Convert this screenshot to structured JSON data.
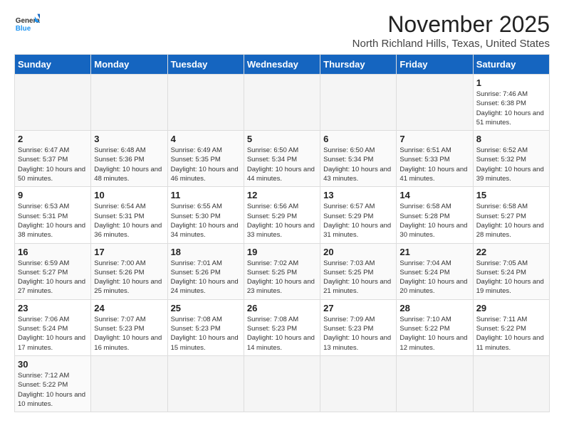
{
  "app": {
    "logo_general": "General",
    "logo_blue": "Blue"
  },
  "header": {
    "month": "November 2025",
    "location": "North Richland Hills, Texas, United States"
  },
  "weekdays": [
    "Sunday",
    "Monday",
    "Tuesday",
    "Wednesday",
    "Thursday",
    "Friday",
    "Saturday"
  ],
  "weeks": [
    [
      {
        "day": null,
        "info": null
      },
      {
        "day": null,
        "info": null
      },
      {
        "day": null,
        "info": null
      },
      {
        "day": null,
        "info": null
      },
      {
        "day": null,
        "info": null
      },
      {
        "day": null,
        "info": null
      },
      {
        "day": "1",
        "info": "Sunrise: 7:46 AM\nSunset: 6:38 PM\nDaylight: 10 hours\nand 51 minutes."
      }
    ],
    [
      {
        "day": "2",
        "info": "Sunrise: 6:47 AM\nSunset: 5:37 PM\nDaylight: 10 hours\nand 50 minutes."
      },
      {
        "day": "3",
        "info": "Sunrise: 6:48 AM\nSunset: 5:36 PM\nDaylight: 10 hours\nand 48 minutes."
      },
      {
        "day": "4",
        "info": "Sunrise: 6:49 AM\nSunset: 5:35 PM\nDaylight: 10 hours\nand 46 minutes."
      },
      {
        "day": "5",
        "info": "Sunrise: 6:50 AM\nSunset: 5:34 PM\nDaylight: 10 hours\nand 44 minutes."
      },
      {
        "day": "6",
        "info": "Sunrise: 6:50 AM\nSunset: 5:34 PM\nDaylight: 10 hours\nand 43 minutes."
      },
      {
        "day": "7",
        "info": "Sunrise: 6:51 AM\nSunset: 5:33 PM\nDaylight: 10 hours\nand 41 minutes."
      },
      {
        "day": "8",
        "info": "Sunrise: 6:52 AM\nSunset: 5:32 PM\nDaylight: 10 hours\nand 39 minutes."
      }
    ],
    [
      {
        "day": "9",
        "info": "Sunrise: 6:53 AM\nSunset: 5:31 PM\nDaylight: 10 hours\nand 38 minutes."
      },
      {
        "day": "10",
        "info": "Sunrise: 6:54 AM\nSunset: 5:31 PM\nDaylight: 10 hours\nand 36 minutes."
      },
      {
        "day": "11",
        "info": "Sunrise: 6:55 AM\nSunset: 5:30 PM\nDaylight: 10 hours\nand 34 minutes."
      },
      {
        "day": "12",
        "info": "Sunrise: 6:56 AM\nSunset: 5:29 PM\nDaylight: 10 hours\nand 33 minutes."
      },
      {
        "day": "13",
        "info": "Sunrise: 6:57 AM\nSunset: 5:29 PM\nDaylight: 10 hours\nand 31 minutes."
      },
      {
        "day": "14",
        "info": "Sunrise: 6:58 AM\nSunset: 5:28 PM\nDaylight: 10 hours\nand 30 minutes."
      },
      {
        "day": "15",
        "info": "Sunrise: 6:58 AM\nSunset: 5:27 PM\nDaylight: 10 hours\nand 28 minutes."
      }
    ],
    [
      {
        "day": "16",
        "info": "Sunrise: 6:59 AM\nSunset: 5:27 PM\nDaylight: 10 hours\nand 27 minutes."
      },
      {
        "day": "17",
        "info": "Sunrise: 7:00 AM\nSunset: 5:26 PM\nDaylight: 10 hours\nand 25 minutes."
      },
      {
        "day": "18",
        "info": "Sunrise: 7:01 AM\nSunset: 5:26 PM\nDaylight: 10 hours\nand 24 minutes."
      },
      {
        "day": "19",
        "info": "Sunrise: 7:02 AM\nSunset: 5:25 PM\nDaylight: 10 hours\nand 23 minutes."
      },
      {
        "day": "20",
        "info": "Sunrise: 7:03 AM\nSunset: 5:25 PM\nDaylight: 10 hours\nand 21 minutes."
      },
      {
        "day": "21",
        "info": "Sunrise: 7:04 AM\nSunset: 5:24 PM\nDaylight: 10 hours\nand 20 minutes."
      },
      {
        "day": "22",
        "info": "Sunrise: 7:05 AM\nSunset: 5:24 PM\nDaylight: 10 hours\nand 19 minutes."
      }
    ],
    [
      {
        "day": "23",
        "info": "Sunrise: 7:06 AM\nSunset: 5:24 PM\nDaylight: 10 hours\nand 17 minutes."
      },
      {
        "day": "24",
        "info": "Sunrise: 7:07 AM\nSunset: 5:23 PM\nDaylight: 10 hours\nand 16 minutes."
      },
      {
        "day": "25",
        "info": "Sunrise: 7:08 AM\nSunset: 5:23 PM\nDaylight: 10 hours\nand 15 minutes."
      },
      {
        "day": "26",
        "info": "Sunrise: 7:08 AM\nSunset: 5:23 PM\nDaylight: 10 hours\nand 14 minutes."
      },
      {
        "day": "27",
        "info": "Sunrise: 7:09 AM\nSunset: 5:23 PM\nDaylight: 10 hours\nand 13 minutes."
      },
      {
        "day": "28",
        "info": "Sunrise: 7:10 AM\nSunset: 5:22 PM\nDaylight: 10 hours\nand 12 minutes."
      },
      {
        "day": "29",
        "info": "Sunrise: 7:11 AM\nSunset: 5:22 PM\nDaylight: 10 hours\nand 11 minutes."
      }
    ],
    [
      {
        "day": "30",
        "info": "Sunrise: 7:12 AM\nSunset: 5:22 PM\nDaylight: 10 hours\nand 10 minutes."
      },
      {
        "day": null,
        "info": null
      },
      {
        "day": null,
        "info": null
      },
      {
        "day": null,
        "info": null
      },
      {
        "day": null,
        "info": null
      },
      {
        "day": null,
        "info": null
      },
      {
        "day": null,
        "info": null
      }
    ]
  ]
}
